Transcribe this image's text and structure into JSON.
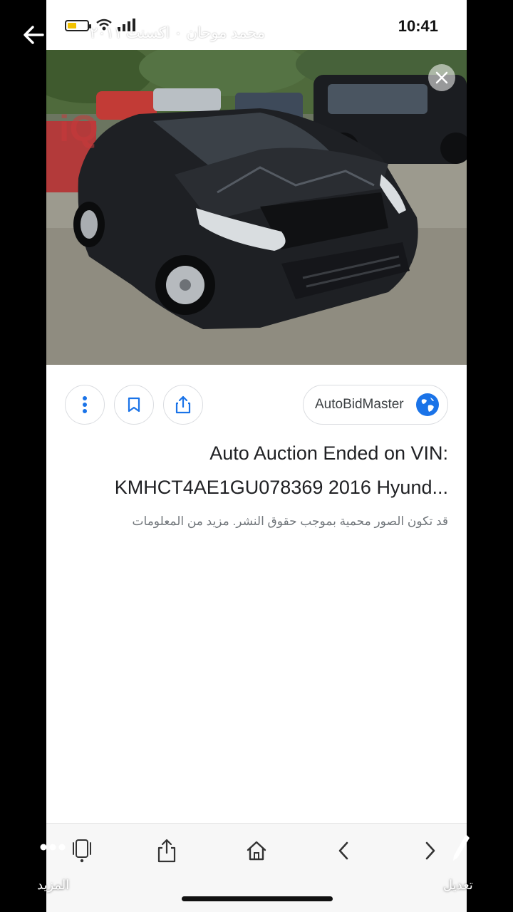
{
  "status_bar": {
    "time": "10:41",
    "battery_color": "#f2c200"
  },
  "overlay": {
    "chat_title": "محمد موحان ٠ اكسنت ٢٠١١",
    "edit_label": "تعديل",
    "more_label": "المزيد"
  },
  "result": {
    "source": "AutoBidMaster",
    "title_line1": "Auto Auction Ended on VIN:",
    "title_line2": "KMHCT4AE1GU078369 2016 Hyund...",
    "copyright_note": "قد تكون الصور محمية بموجب حقوق النشر. مزيد من المعلومات"
  },
  "icons": {
    "back": "arrow-left-icon",
    "close": "close-icon",
    "more_vert": "more-vert-icon",
    "bookmark": "bookmark-icon",
    "share": "share-icon",
    "globe": "globe-icon",
    "tabs": "tabs-icon",
    "home": "home-icon",
    "nav_back": "chevron-left-icon",
    "nav_forward": "chevron-right-icon",
    "edit": "pen-icon",
    "more": "more-dots-icon"
  },
  "colors": {
    "accent": "#1a73e8",
    "text_primary": "#202124",
    "text_secondary": "#70757a"
  }
}
